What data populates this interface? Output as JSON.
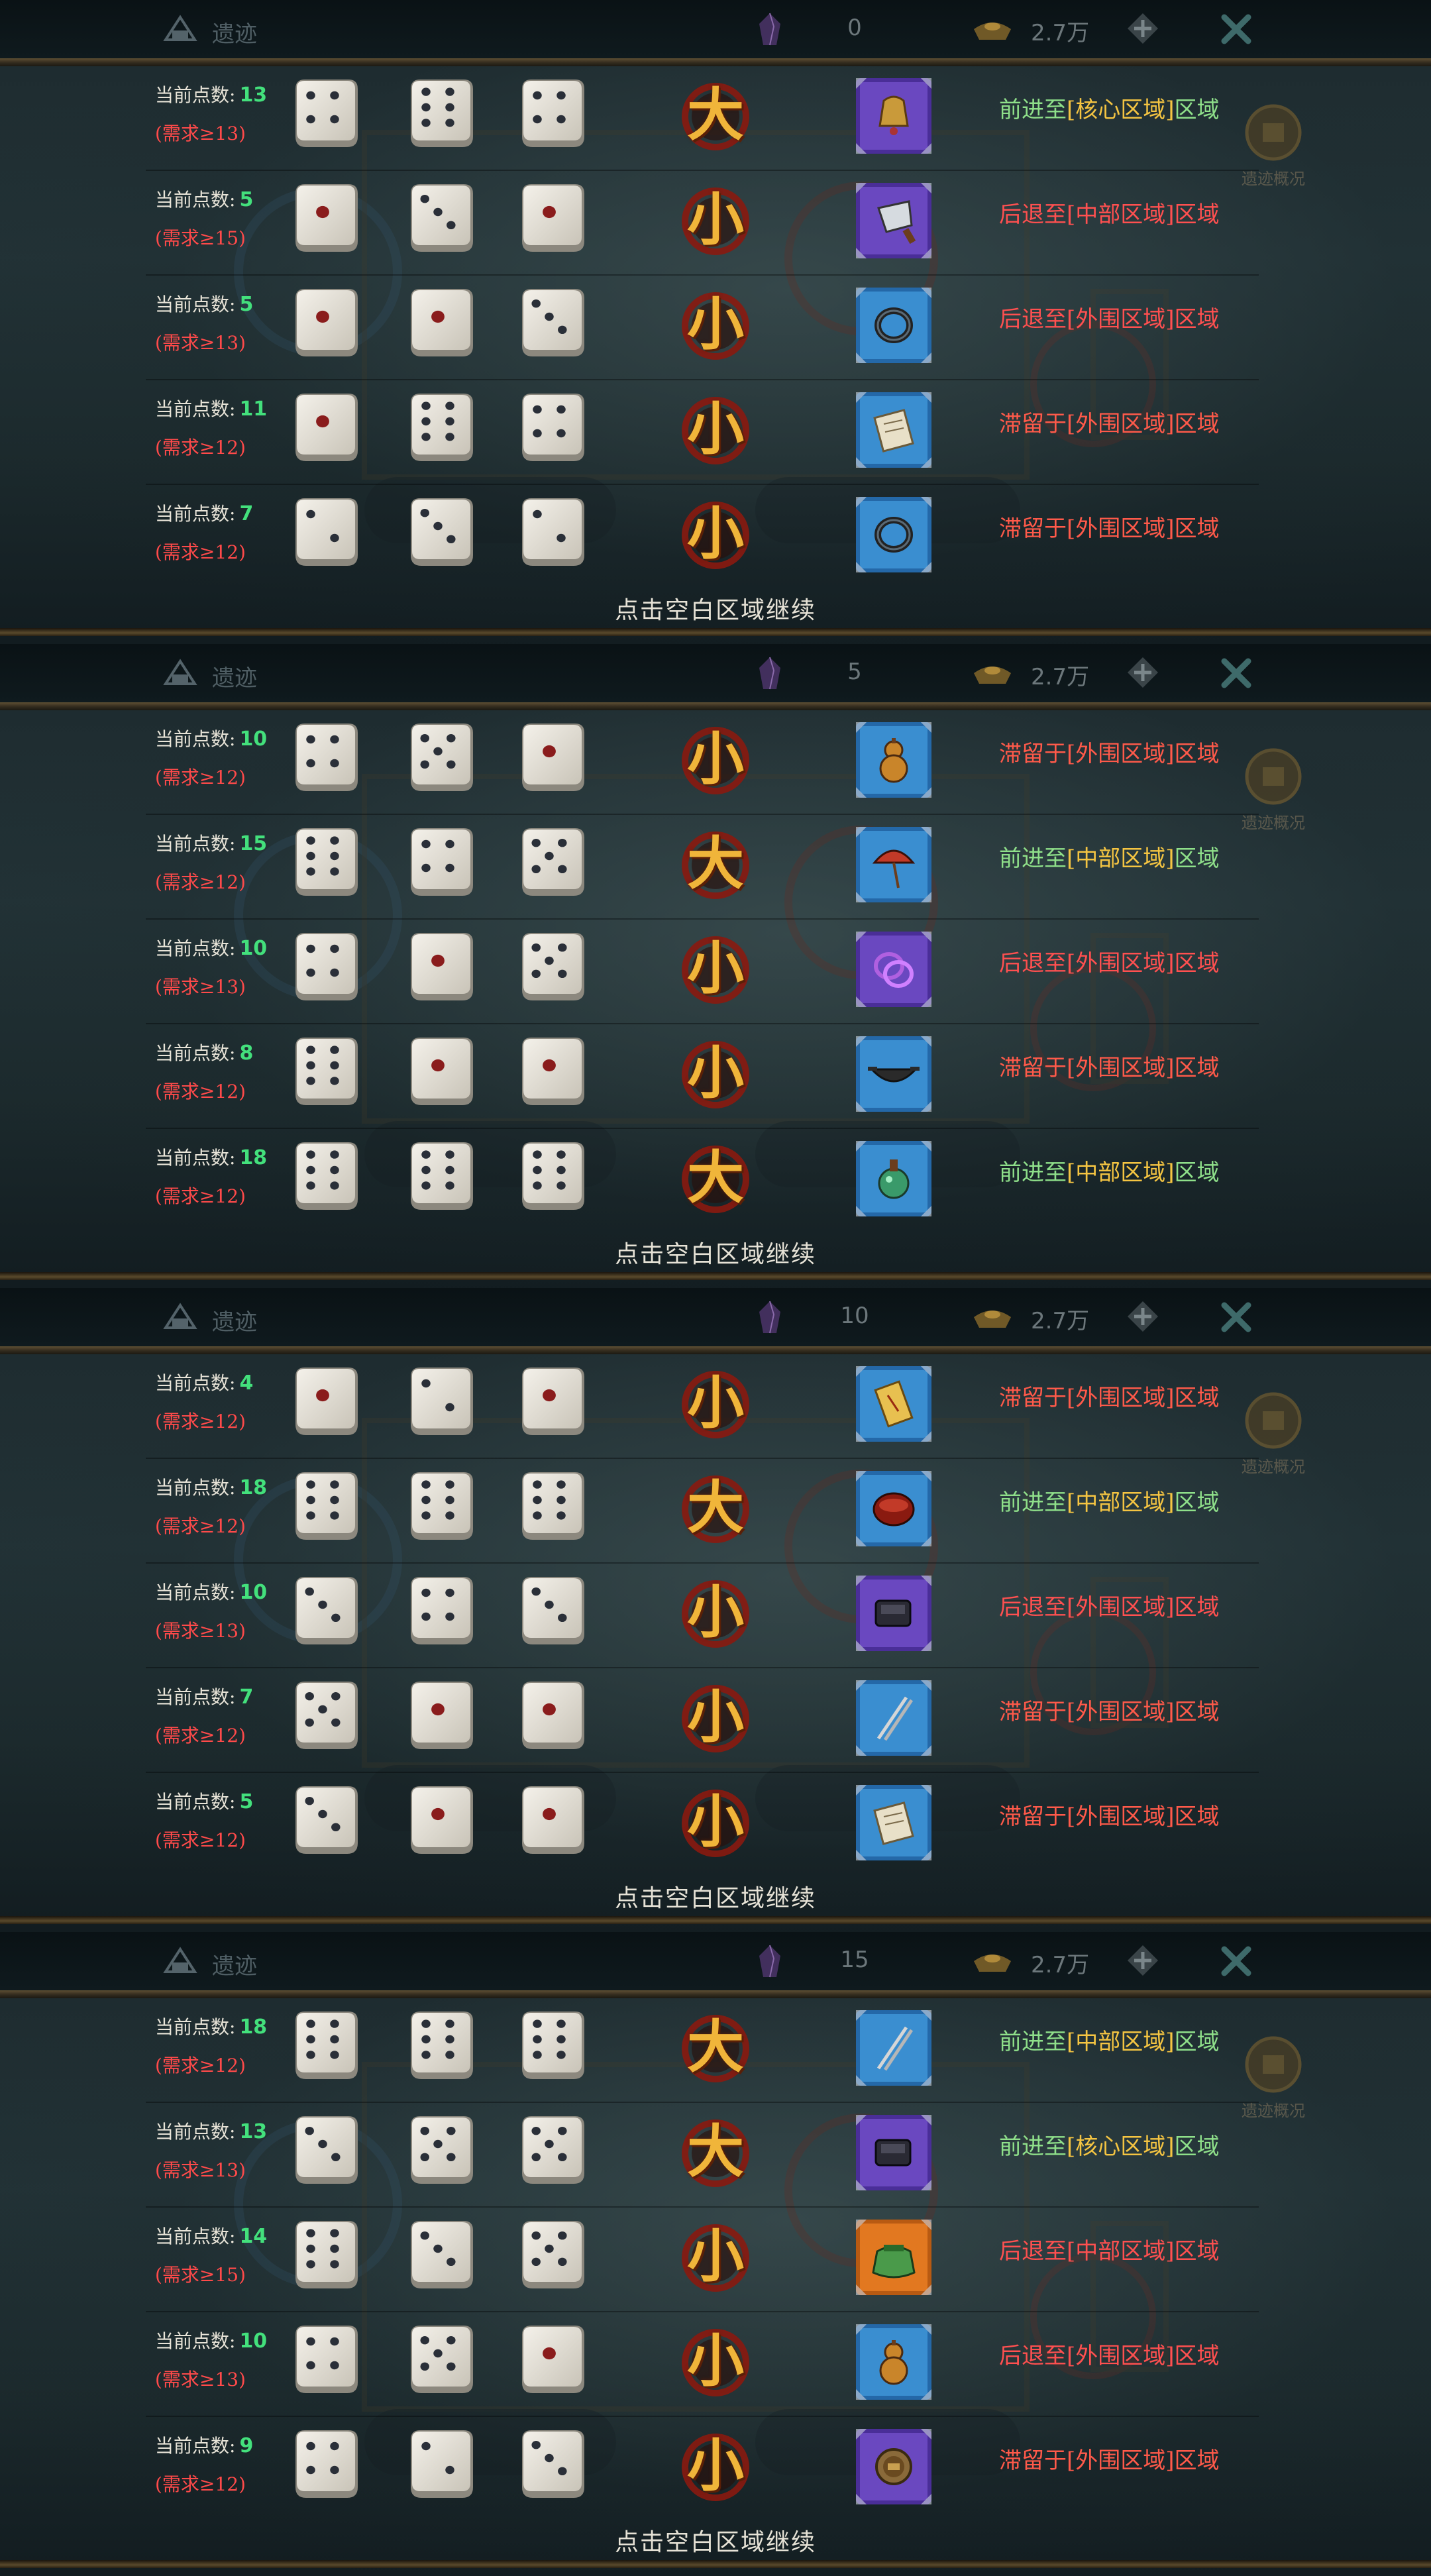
{
  "ui": {
    "title": "遗迹",
    "points_prefix": "当前点数:",
    "continue_text": "点击空白区域继续",
    "side_button_label": "遗迹概况",
    "coin_value": "2.7万"
  },
  "icons": {
    "big_result": "da-big-char",
    "small_result": "xiao-small-char",
    "gem": "purple-gem-icon",
    "ingot": "gold-ingot-icon",
    "plus": "plus-icon",
    "close": "close-x-icon"
  },
  "colors": {
    "points_value": "#43e07c",
    "requirement": "#ff4a4a",
    "advance_green": "#8fe08a",
    "region_yellow": "#f5c542",
    "retreat_red": "#ff5050",
    "stay_red": "#ff5a4a",
    "rarity_blue": "#3a8ed0",
    "rarity_purple": "#7b4fc8",
    "rarity_orange": "#e07a22"
  },
  "panels": [
    {
      "gem_value": "0",
      "rows": [
        {
          "points": "13",
          "requirement": "(需求≥13)",
          "dice": [
            4,
            6,
            4
          ],
          "result": "大",
          "item": "bell",
          "rarity": "purple",
          "outcome": {
            "verb": "前进至",
            "region": "[核心区域]",
            "suffix": "区域",
            "type": "advance"
          }
        },
        {
          "points": "5",
          "requirement": "(需求≥15)",
          "dice": [
            1,
            3,
            1
          ],
          "result": "小",
          "item": "cleaver",
          "rarity": "purple",
          "outcome": {
            "verb": "后退至",
            "region": "[中部区域]",
            "suffix": "区域",
            "type": "retreat"
          }
        },
        {
          "points": "5",
          "requirement": "(需求≥13)",
          "dice": [
            1,
            1,
            3
          ],
          "result": "小",
          "item": "bracelet",
          "rarity": "blue",
          "outcome": {
            "verb": "后退至",
            "region": "[外围区域]",
            "suffix": "区域",
            "type": "retreat"
          }
        },
        {
          "points": "11",
          "requirement": "(需求≥12)",
          "dice": [
            1,
            6,
            4
          ],
          "result": "小",
          "item": "scroll",
          "rarity": "blue",
          "outcome": {
            "verb": "滞留于",
            "region": "[外围区域]",
            "suffix": "区域",
            "type": "stay"
          }
        },
        {
          "points": "7",
          "requirement": "(需求≥12)",
          "dice": [
            2,
            3,
            2
          ],
          "result": "小",
          "item": "bracelet",
          "rarity": "blue",
          "outcome": {
            "verb": "滞留于",
            "region": "[外围区域]",
            "suffix": "区域",
            "type": "stay"
          }
        }
      ]
    },
    {
      "gem_value": "5",
      "rows": [
        {
          "points": "10",
          "requirement": "(需求≥12)",
          "dice": [
            4,
            5,
            1
          ],
          "result": "小",
          "item": "gourd",
          "rarity": "blue",
          "outcome": {
            "verb": "滞留于",
            "region": "[外围区域]",
            "suffix": "区域",
            "type": "stay"
          }
        },
        {
          "points": "15",
          "requirement": "(需求≥12)",
          "dice": [
            6,
            4,
            5
          ],
          "result": "大",
          "item": "umbrella",
          "rarity": "blue",
          "outcome": {
            "verb": "前进至",
            "region": "[中部区域]",
            "suffix": "区域",
            "type": "advance"
          }
        },
        {
          "points": "10",
          "requirement": "(需求≥13)",
          "dice": [
            4,
            1,
            5
          ],
          "result": "小",
          "item": "rings",
          "rarity": "purple",
          "outcome": {
            "verb": "后退至",
            "region": "[外围区域]",
            "suffix": "区域",
            "type": "retreat"
          }
        },
        {
          "points": "8",
          "requirement": "(需求≥12)",
          "dice": [
            6,
            1,
            1
          ],
          "result": "小",
          "item": "wok",
          "rarity": "blue",
          "outcome": {
            "verb": "滞留于",
            "region": "[外围区域]",
            "suffix": "区域",
            "type": "stay"
          }
        },
        {
          "points": "18",
          "requirement": "(需求≥12)",
          "dice": [
            6,
            6,
            6
          ],
          "result": "大",
          "item": "potion",
          "rarity": "blue",
          "outcome": {
            "verb": "前进至",
            "region": "[中部区域]",
            "suffix": "区域",
            "type": "advance"
          }
        }
      ]
    },
    {
      "gem_value": "10",
      "rows": [
        {
          "points": "4",
          "requirement": "(需求≥12)",
          "dice": [
            1,
            2,
            1
          ],
          "result": "小",
          "item": "talisman",
          "rarity": "blue",
          "outcome": {
            "verb": "滞留于",
            "region": "[外围区域]",
            "suffix": "区域",
            "type": "stay"
          }
        },
        {
          "points": "18",
          "requirement": "(需求≥12)",
          "dice": [
            6,
            6,
            6
          ],
          "result": "大",
          "item": "bowl",
          "rarity": "blue",
          "outcome": {
            "verb": "前进至",
            "region": "[中部区域]",
            "suffix": "区域",
            "type": "advance"
          }
        },
        {
          "points": "10",
          "requirement": "(需求≥13)",
          "dice": [
            3,
            4,
            3
          ],
          "result": "小",
          "item": "inkstone",
          "rarity": "purple",
          "outcome": {
            "verb": "后退至",
            "region": "[外围区域]",
            "suffix": "区域",
            "type": "retreat"
          }
        },
        {
          "points": "7",
          "requirement": "(需求≥12)",
          "dice": [
            5,
            1,
            1
          ],
          "result": "小",
          "item": "chopsticks",
          "rarity": "blue",
          "outcome": {
            "verb": "滞留于",
            "region": "[外围区域]",
            "suffix": "区域",
            "type": "stay"
          }
        },
        {
          "points": "5",
          "requirement": "(需求≥12)",
          "dice": [
            3,
            1,
            1
          ],
          "result": "小",
          "item": "scroll",
          "rarity": "blue",
          "outcome": {
            "verb": "滞留于",
            "region": "[外围区域]",
            "suffix": "区域",
            "type": "stay"
          }
        }
      ]
    },
    {
      "gem_value": "15",
      "rows": [
        {
          "points": "18",
          "requirement": "(需求≥12)",
          "dice": [
            6,
            6,
            6
          ],
          "result": "大",
          "item": "chopsticks",
          "rarity": "blue",
          "outcome": {
            "verb": "前进至",
            "region": "[中部区域]",
            "suffix": "区域",
            "type": "advance"
          }
        },
        {
          "points": "13",
          "requirement": "(需求≥13)",
          "dice": [
            3,
            5,
            5
          ],
          "result": "大",
          "item": "inkstone",
          "rarity": "purple",
          "outcome": {
            "verb": "前进至",
            "region": "[核心区域]",
            "suffix": "区域",
            "type": "advance"
          }
        },
        {
          "points": "14",
          "requirement": "(需求≥15)",
          "dice": [
            6,
            3,
            5
          ],
          "result": "小",
          "item": "pouch",
          "rarity": "orange",
          "outcome": {
            "verb": "后退至",
            "region": "[中部区域]",
            "suffix": "区域",
            "type": "retreat"
          }
        },
        {
          "points": "10",
          "requirement": "(需求≥13)",
          "dice": [
            4,
            5,
            1
          ],
          "result": "小",
          "item": "gourd",
          "rarity": "blue",
          "outcome": {
            "verb": "后退至",
            "region": "[外围区域]",
            "suffix": "区域",
            "type": "retreat"
          }
        },
        {
          "points": "9",
          "requirement": "(需求≥12)",
          "dice": [
            4,
            2,
            3
          ],
          "result": "小",
          "item": "coin",
          "rarity": "purple",
          "outcome": {
            "verb": "滞留于",
            "region": "[外围区域]",
            "suffix": "区域",
            "type": "stay"
          }
        }
      ]
    }
  ]
}
